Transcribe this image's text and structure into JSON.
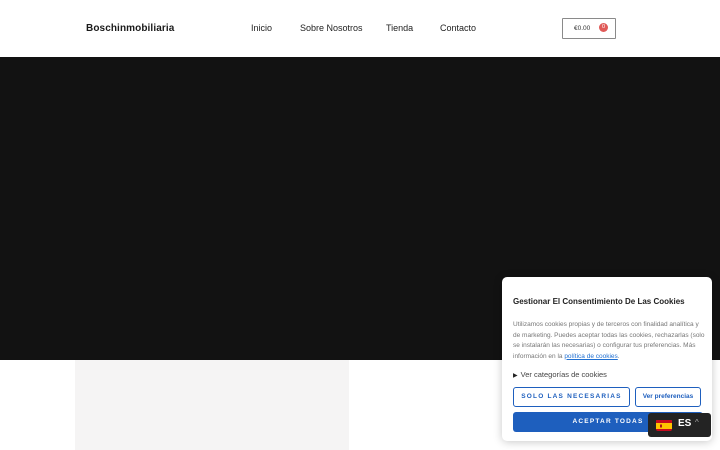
{
  "header": {
    "brand": "Boschinmobiliaria",
    "nav": [
      "Inicio",
      "Sobre Nosotros",
      "Tienda",
      "Contacto"
    ],
    "cart_total": "€0.00",
    "cart_count": "0"
  },
  "cookie_banner": {
    "title": "Gestionar El Consentimiento De Las Cookies",
    "body": "Utilizamos cookies propias y de terceros con finalidad analítica y de marketing. Puedes aceptar todas las cookies, rechazarlas (solo se instalarán las necesarias) o configurar tus preferencias. Más información en la",
    "link_text": "política de cookies",
    "link_after": ".",
    "categories_label": "Ver categorías de cookies",
    "btn_necessary": "SOLO LAS NECESARIAS",
    "btn_preferences": "Ver preferencias",
    "btn_accept": "ACEPTAR TODAS"
  },
  "language": {
    "code": "ES",
    "flag_icon": "spain-flag-icon"
  }
}
